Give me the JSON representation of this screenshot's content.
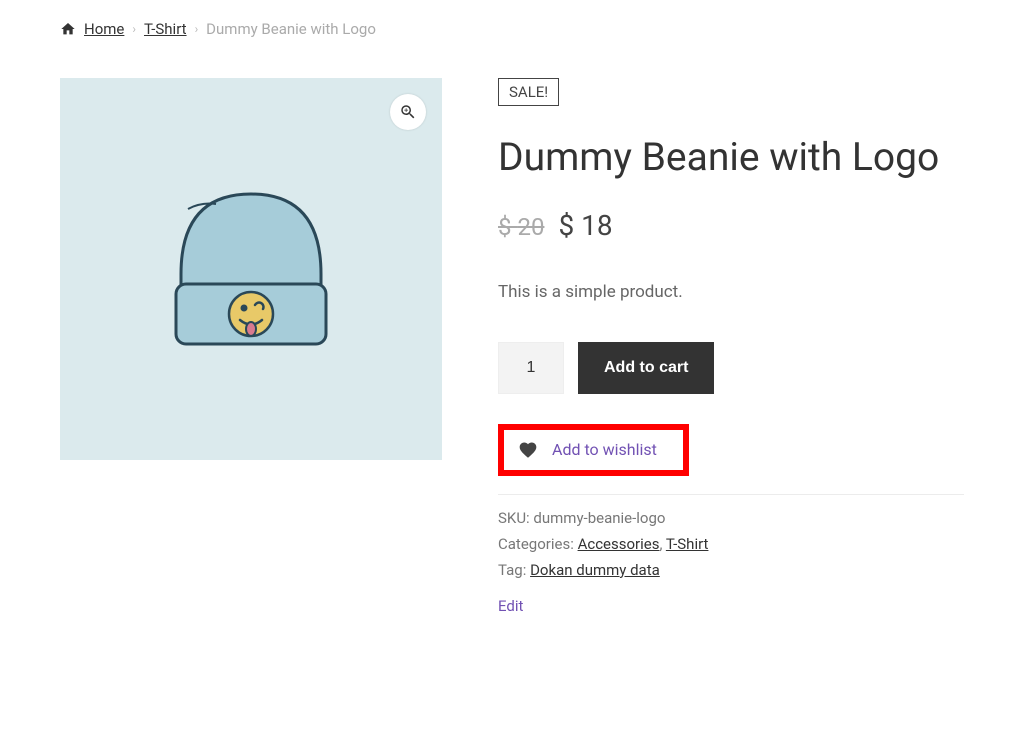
{
  "breadcrumb": {
    "home": "Home",
    "category": "T-Shirt",
    "current": "Dummy Beanie with Logo"
  },
  "product": {
    "sale_badge": "SALE!",
    "title": "Dummy Beanie with Logo",
    "currency": "$",
    "price_old": "20",
    "price_new": "18",
    "description": "This is a simple product.",
    "qty_value": "1",
    "add_to_cart_label": "Add to cart",
    "wishlist_label": "Add to wishlist"
  },
  "meta": {
    "sku_label": "SKU:",
    "sku_value": "dummy-beanie-logo",
    "categories_label": "Categories:",
    "categories": [
      "Accessories",
      "T-Shirt"
    ],
    "tag_label": "Tag:",
    "tag_value": "Dokan dummy data",
    "edit_label": "Edit"
  }
}
